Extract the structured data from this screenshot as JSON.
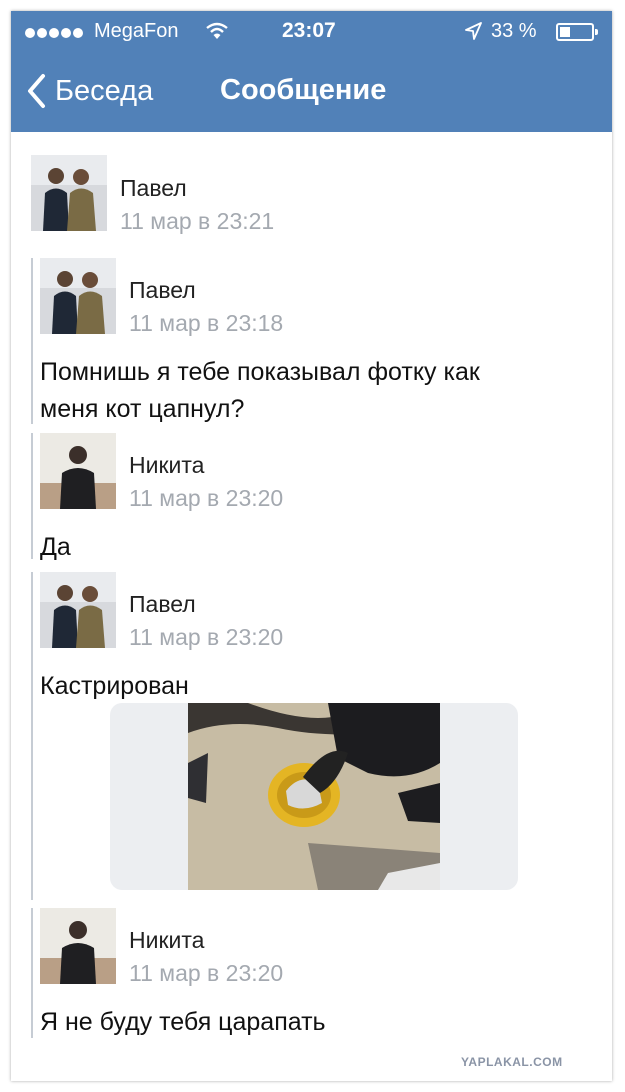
{
  "status_bar": {
    "carrier": "MegaFon",
    "time": "23:07",
    "battery": "33 %"
  },
  "nav": {
    "back_label": "Беседа",
    "title": "Сообщение"
  },
  "header": {
    "author": "Павел",
    "date": "11 мар в 23:21"
  },
  "messages": [
    {
      "author": "Павел",
      "date": "11 мар в 23:18",
      "lines": [
        "Помнишь я тебе показывал фотку как",
        "меня кот цапнул?"
      ]
    },
    {
      "author": "Никита",
      "date": "11 мар в 23:20",
      "lines": [
        "Да"
      ]
    },
    {
      "author": "Павел",
      "date": "11 мар в 23:20",
      "lines": [
        "Кастрирован"
      ]
    },
    {
      "author": "Никита",
      "date": "11 мар в 23:20",
      "lines": [
        "Я не буду тебя царапать"
      ]
    }
  ],
  "watermark": "YAPLAKAL.COM",
  "colors": {
    "header_bg": "#5181b8",
    "timestamp": "#a4a9b0",
    "thread_line": "#c6ccd4"
  }
}
